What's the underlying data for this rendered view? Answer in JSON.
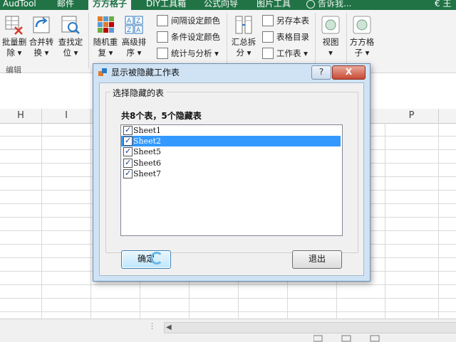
{
  "ribbon_tabs": {
    "t0": "AudTool",
    "t1": "邮件",
    "t2": "方方格子",
    "t3": "DIY工具箱",
    "t4": "公式向导",
    "t5": "图片工具",
    "tell_me": "告诉我...",
    "user": "€ 王"
  },
  "ribbon": {
    "big_buttons": [
      {
        "label1": "批量删",
        "label2": "除 ▾"
      },
      {
        "label1": "合并转",
        "label2": "换 ▾"
      },
      {
        "label1": "查找定",
        "label2": "位 ▾"
      },
      {
        "label1": "随机重",
        "label2": "复 ▾"
      },
      {
        "label1": "高级排",
        "label2": "序 ▾"
      },
      {
        "label1": "汇总拆",
        "label2": "分 ▾"
      },
      {
        "label1": "视图",
        "label2": "▾"
      },
      {
        "label1": "方方格",
        "label2": "子 ▾"
      }
    ],
    "small_buttons": [
      "间隔设定颜色",
      "条件设定颜色",
      "统计与分析 ▾",
      "另存本表",
      "表格目录",
      "工作表 ▾"
    ],
    "group_label": "编辑"
  },
  "sheet": {
    "columns": [
      "H",
      "I",
      "P"
    ]
  },
  "dialog": {
    "title": "显示被隐藏工作表",
    "help": "?",
    "close": "X",
    "group_title": "选择隐藏的表",
    "count_label": "共8个表，5个隐藏表",
    "items": [
      {
        "name": "Sheet1",
        "checked": true,
        "selected": false
      },
      {
        "name": "Sheet2",
        "checked": true,
        "selected": true
      },
      {
        "name": "Sheet5",
        "checked": true,
        "selected": false
      },
      {
        "name": "Sheet6",
        "checked": true,
        "selected": false
      },
      {
        "name": "Sheet7",
        "checked": true,
        "selected": false
      }
    ],
    "ok_label": "确定",
    "exit_label": "退出"
  },
  "colors": {
    "excel_green": "#217346",
    "selection_blue": "#3399ff",
    "dialog_frame": "#cfe3f5"
  }
}
